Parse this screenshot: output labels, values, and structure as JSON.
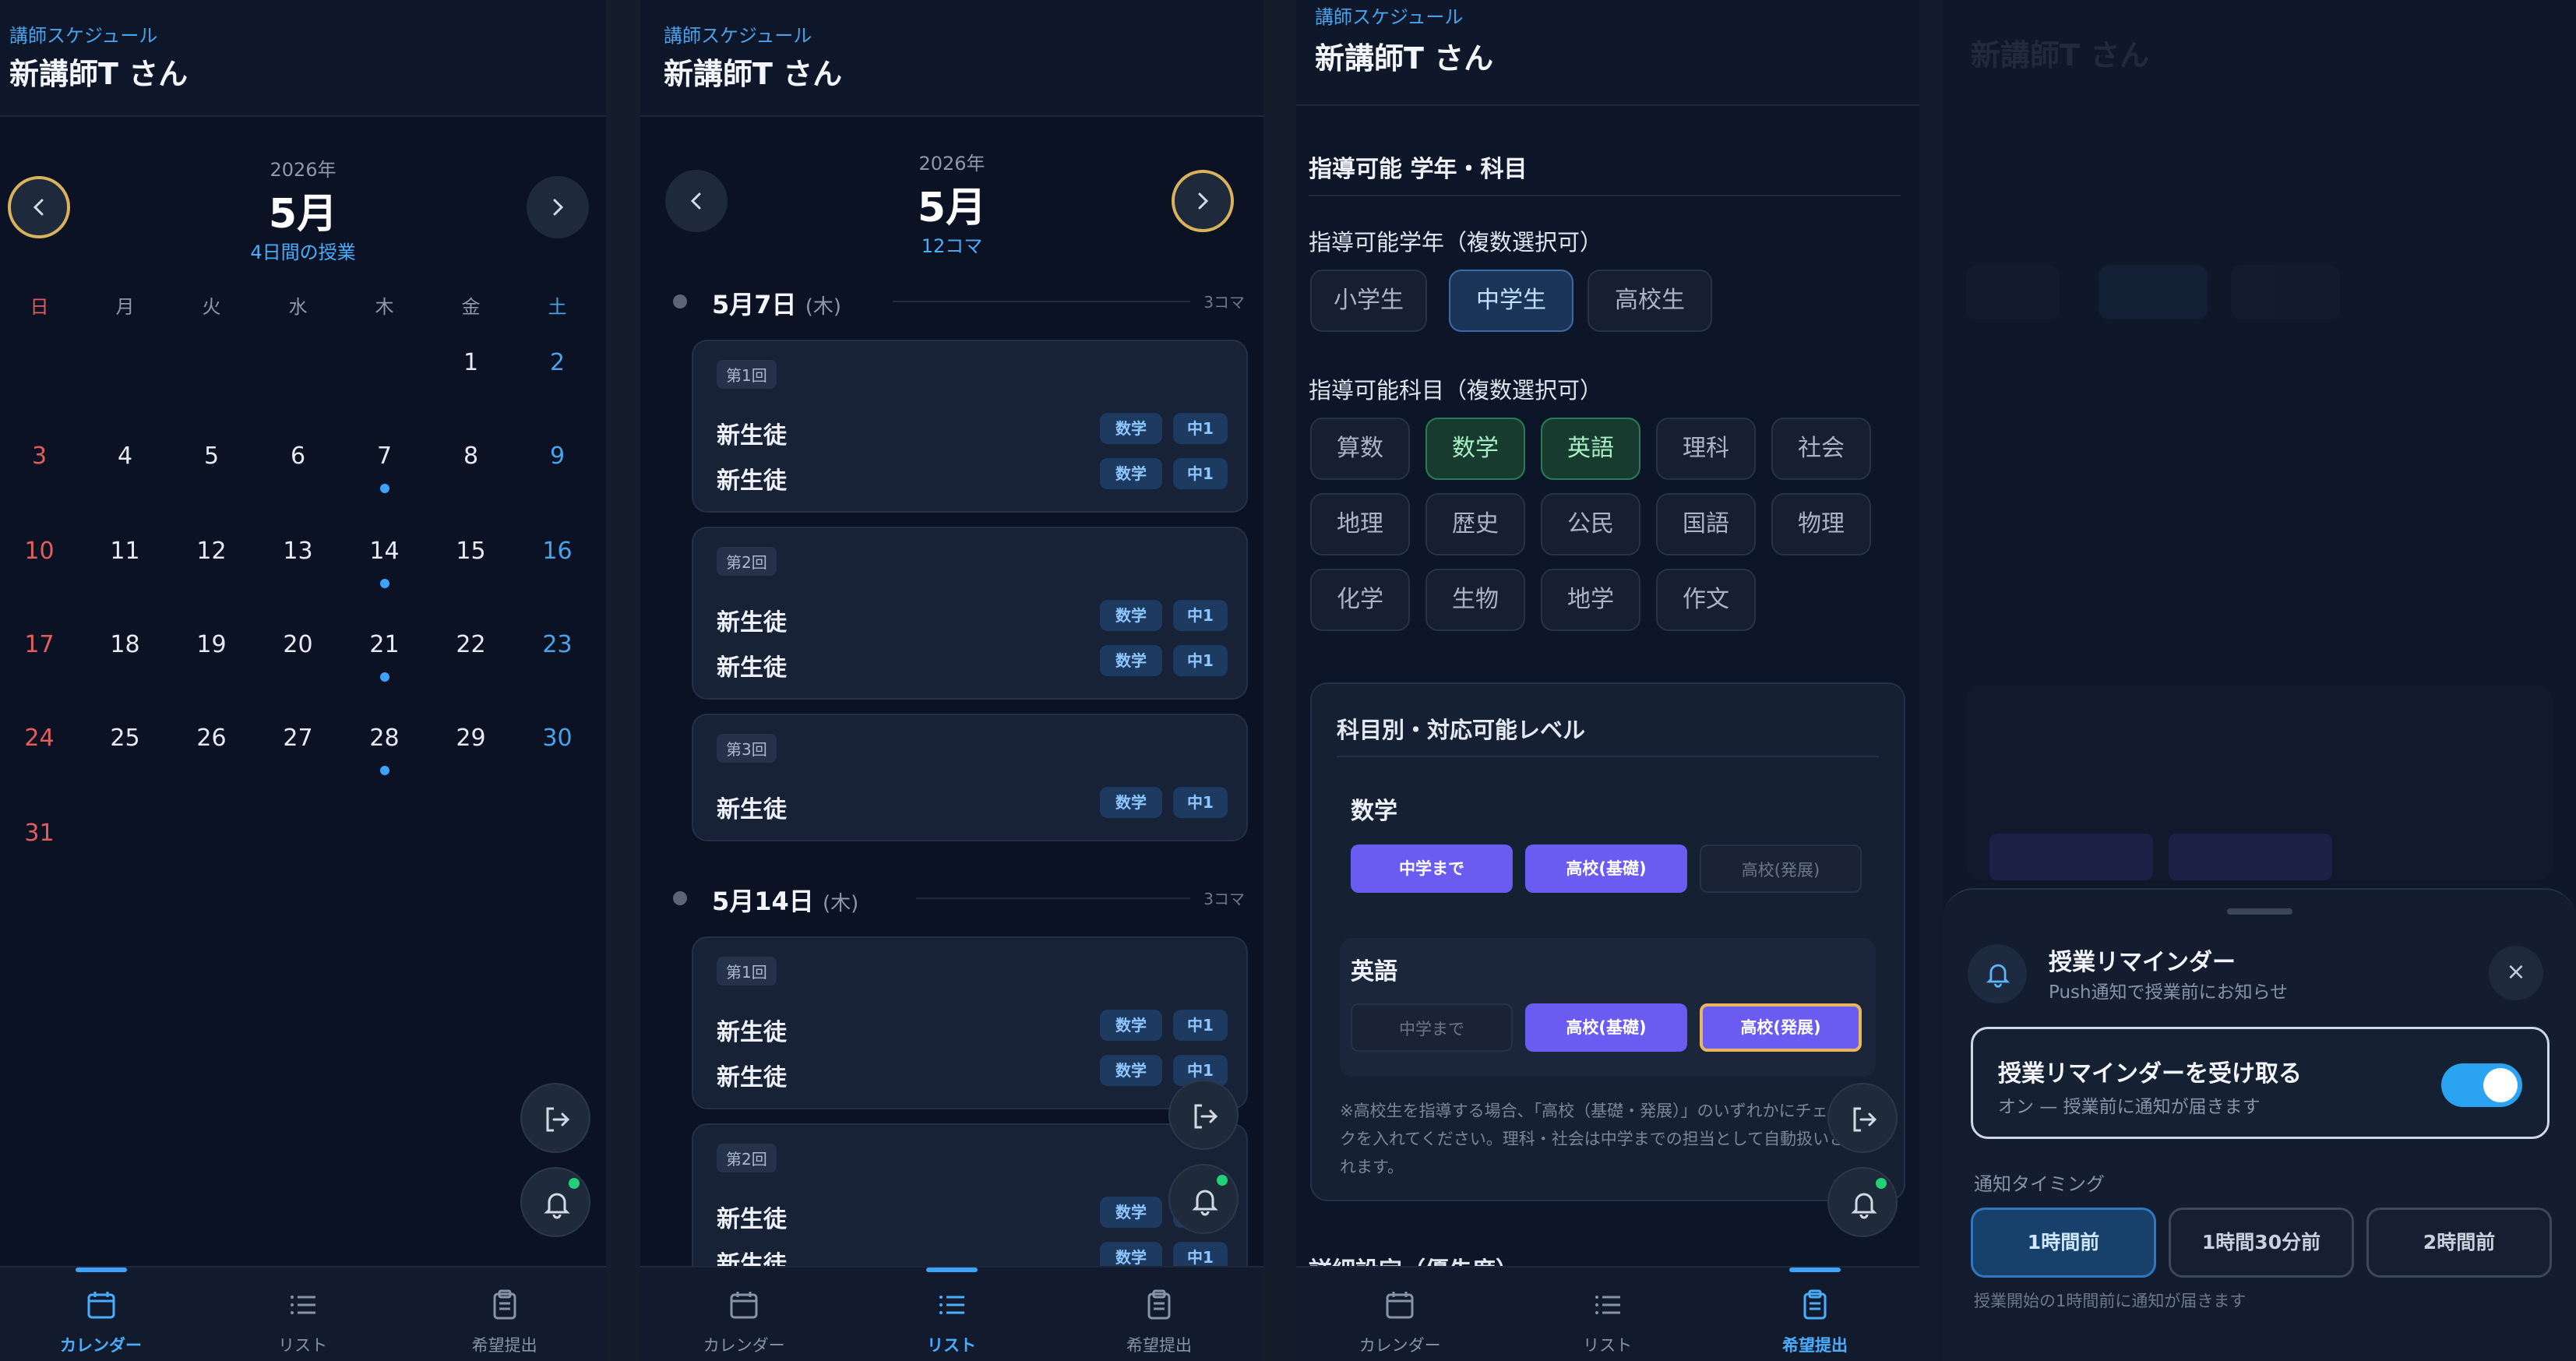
{
  "header": {
    "subtitle": "講師スケジュール",
    "teacher": "新講師T さん"
  },
  "tabs": [
    {
      "label": "カレンダー",
      "icon": "calendar-icon"
    },
    {
      "label": "リスト",
      "icon": "list-icon"
    },
    {
      "label": "希望提出",
      "icon": "clipboard-icon"
    }
  ],
  "calendar": {
    "year": "2026年",
    "month": "5月",
    "note": "4日間の授業",
    "weekdays": [
      "日",
      "月",
      "火",
      "水",
      "木",
      "金",
      "土"
    ],
    "days": [
      "1",
      "2",
      "3",
      "4",
      "5",
      "6",
      "7",
      "8",
      "9",
      "10",
      "11",
      "12",
      "13",
      "14",
      "15",
      "16",
      "17",
      "18",
      "19",
      "20",
      "21",
      "22",
      "23",
      "24",
      "25",
      "26",
      "27",
      "28",
      "29",
      "30",
      "31"
    ],
    "lesson_days": [
      7,
      14,
      21,
      28
    ],
    "colors": {
      "sunday": "#e35d5d",
      "saturday": "#4aa3ea"
    }
  },
  "list": {
    "year": "2026年",
    "month": "5月",
    "count": "12コマ",
    "dates": [
      {
        "label": "5月7日",
        "weekday": "(木)",
        "count": "3コマ",
        "lessons": [
          {
            "no": "第1回",
            "students": [
              {
                "name": "新生徒",
                "subject": "数学",
                "grade": "中1"
              },
              {
                "name": "新生徒",
                "subject": "数学",
                "grade": "中1"
              }
            ]
          },
          {
            "no": "第2回",
            "students": [
              {
                "name": "新生徒",
                "subject": "数学",
                "grade": "中1"
              },
              {
                "name": "新生徒",
                "subject": "数学",
                "grade": "中1"
              }
            ]
          },
          {
            "no": "第3回",
            "students": [
              {
                "name": "新生徒",
                "subject": "数学",
                "grade": "中1"
              }
            ]
          }
        ]
      },
      {
        "label": "5月14日",
        "weekday": "(木)",
        "count": "3コマ",
        "lessons": [
          {
            "no": "第1回",
            "students": [
              {
                "name": "新生徒",
                "subject": "数学",
                "grade": "中1"
              },
              {
                "name": "新生徒",
                "subject": "数学",
                "grade": "中1"
              }
            ]
          },
          {
            "no": "第2回",
            "students": [
              {
                "name": "新生徒",
                "subject": "数学",
                "grade": "中1"
              },
              {
                "name": "新生徒",
                "subject": "数学",
                "grade": "中1"
              }
            ]
          }
        ]
      }
    ]
  },
  "request": {
    "section_title": "指導可能 学年・科目",
    "grades_label": "指導可能学年（複数選択可）",
    "grades": [
      {
        "label": "小学生",
        "selected": false
      },
      {
        "label": "中学生",
        "selected": true
      },
      {
        "label": "高校生",
        "selected": false
      }
    ],
    "subjects_label": "指導可能科目（複数選択可）",
    "subjects": [
      {
        "label": "算数",
        "selected": false
      },
      {
        "label": "数学",
        "selected": true
      },
      {
        "label": "英語",
        "selected": true
      },
      {
        "label": "理科",
        "selected": false
      },
      {
        "label": "社会",
        "selected": false
      },
      {
        "label": "地理",
        "selected": false
      },
      {
        "label": "歴史",
        "selected": false
      },
      {
        "label": "公民",
        "selected": false
      },
      {
        "label": "国語",
        "selected": false
      },
      {
        "label": "物理",
        "selected": false
      },
      {
        "label": "化学",
        "selected": false
      },
      {
        "label": "生物",
        "selected": false
      },
      {
        "label": "地学",
        "selected": false
      },
      {
        "label": "作文",
        "selected": false
      }
    ],
    "level_title": "科目別・対応可能レベル",
    "levels": [
      {
        "subject": "数学",
        "options": [
          {
            "label": "中学まで",
            "on": true
          },
          {
            "label": "高校(基礎)",
            "on": true
          },
          {
            "label": "高校(発展)",
            "on": false
          }
        ]
      },
      {
        "subject": "英語",
        "options": [
          {
            "label": "中学まで",
            "on": false
          },
          {
            "label": "高校(基礎)",
            "on": true
          },
          {
            "label": "高校(発展)",
            "on": true
          }
        ]
      }
    ],
    "level_note": "※高校生を指導する場合、「高校（基礎・発展）」のいずれかにチェックを入れてください。理科・社会は中学までの担当として自動扱いさ れます。",
    "next_section": "詳細設定（優先度）"
  },
  "reminder": {
    "title": "授業リマインダー",
    "subtitle": "Push通知で授業前にお知らせ",
    "close": "×",
    "toggle_title": "授業リマインダーを受け取る",
    "toggle_sub": "オン — 授業前に通知が届きます",
    "toggle_on": true,
    "timing_label": "通知タイミング",
    "options": [
      "1時間前",
      "1時間30分前",
      "2時間前"
    ],
    "selected": "1時間前",
    "note": "授業開始の1時間前に通知が届きます",
    "accent": "#2aa3f0"
  }
}
